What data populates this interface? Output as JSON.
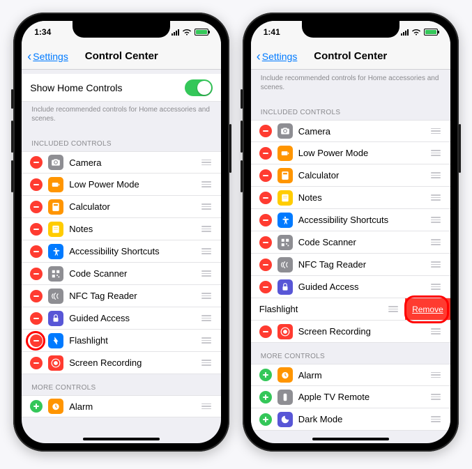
{
  "left": {
    "time": "1:34",
    "navBack": "Settings",
    "navTitle": "Control Center",
    "homeControlsLabel": "Show Home Controls",
    "homeControlsNote": "Include recommended controls for Home accessories and scenes.",
    "includedHeader": "INCLUDED CONTROLS",
    "moreHeader": "MORE CONTROLS",
    "included": [
      {
        "label": "Camera",
        "icon": "camera",
        "ic": "ic-camera"
      },
      {
        "label": "Low Power Mode",
        "icon": "battery",
        "ic": "ic-lpm"
      },
      {
        "label": "Calculator",
        "icon": "calc",
        "ic": "ic-calc"
      },
      {
        "label": "Notes",
        "icon": "notes",
        "ic": "ic-notes"
      },
      {
        "label": "Accessibility Shortcuts",
        "icon": "access",
        "ic": "ic-access"
      },
      {
        "label": "Code Scanner",
        "icon": "qr",
        "ic": "ic-scanner"
      },
      {
        "label": "NFC Tag Reader",
        "icon": "nfc",
        "ic": "ic-nfc"
      },
      {
        "label": "Guided Access",
        "icon": "lock",
        "ic": "ic-guided"
      },
      {
        "label": "Flashlight",
        "icon": "flash",
        "ic": "ic-flash",
        "highlight": true
      },
      {
        "label": "Screen Recording",
        "icon": "record",
        "ic": "ic-rec"
      }
    ],
    "more": [
      {
        "label": "Alarm",
        "icon": "alarm",
        "ic": "ic-alarm"
      }
    ]
  },
  "right": {
    "time": "1:41",
    "navBack": "Settings",
    "navTitle": "Control Center",
    "homeControlsNote": "Include recommended controls for Home accessories and scenes.",
    "includedHeader": "INCLUDED CONTROLS",
    "moreHeader": "MORE CONTROLS",
    "removeLabel": "Remove",
    "included": [
      {
        "label": "Camera",
        "icon": "camera",
        "ic": "ic-camera"
      },
      {
        "label": "Low Power Mode",
        "icon": "battery",
        "ic": "ic-lpm"
      },
      {
        "label": "Calculator",
        "icon": "calc",
        "ic": "ic-calc"
      },
      {
        "label": "Notes",
        "icon": "notes",
        "ic": "ic-notes"
      },
      {
        "label": "Accessibility Shortcuts",
        "icon": "access",
        "ic": "ic-access"
      },
      {
        "label": "Code Scanner",
        "icon": "qr",
        "ic": "ic-scanner"
      },
      {
        "label": "NFC Tag Reader",
        "icon": "nfc",
        "ic": "ic-nfc"
      },
      {
        "label": "Guided Access",
        "icon": "lock",
        "ic": "ic-guided"
      },
      {
        "label": "Flashlight",
        "icon": "flash",
        "ic": "ic-flash",
        "swiped": true
      },
      {
        "label": "Screen Recording",
        "icon": "record",
        "ic": "ic-rec"
      }
    ],
    "more": [
      {
        "label": "Alarm",
        "icon": "alarm",
        "ic": "ic-alarm"
      },
      {
        "label": "Apple TV Remote",
        "icon": "atv",
        "ic": "ic-atv"
      },
      {
        "label": "Dark Mode",
        "icon": "dark",
        "ic": "ic-dark"
      }
    ]
  }
}
